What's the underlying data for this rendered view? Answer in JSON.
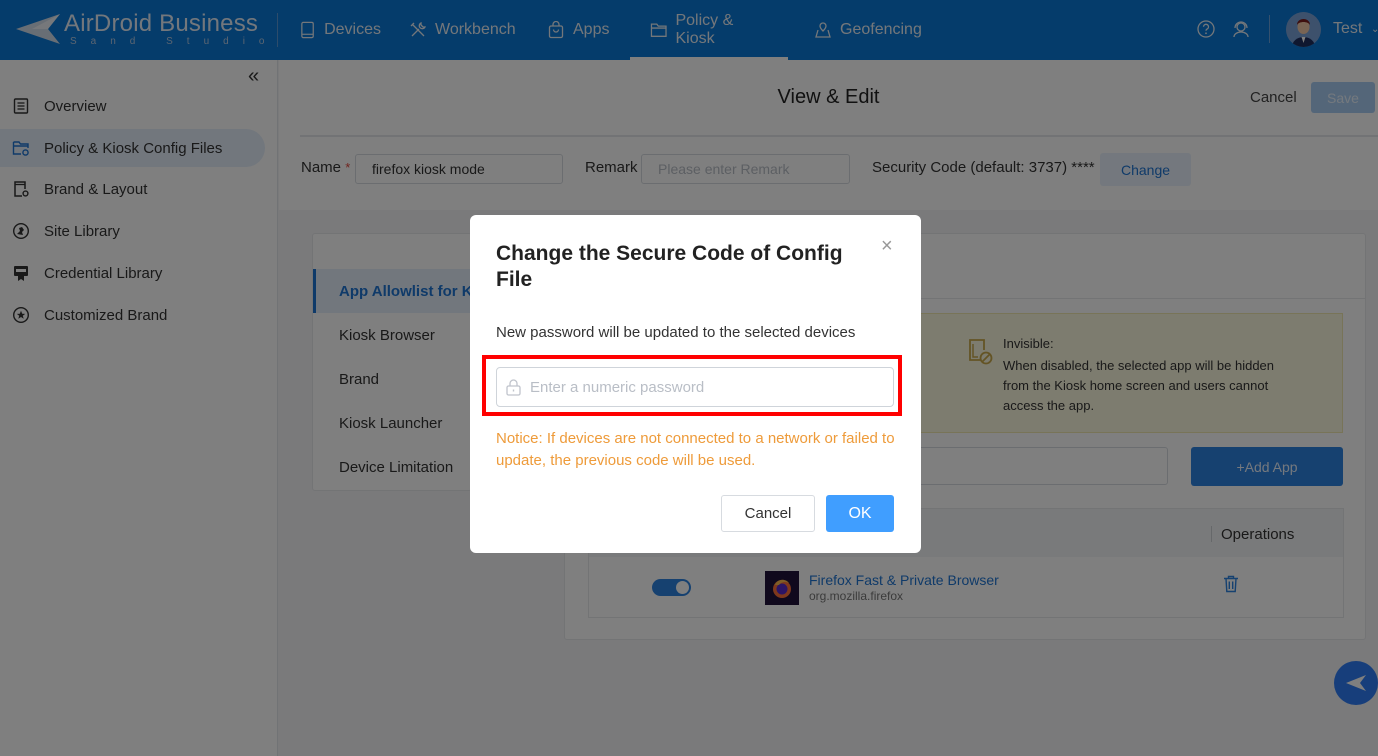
{
  "app": {
    "brand_name": "AirDroid Business",
    "brand_sub": "Sand Studio"
  },
  "topnav": {
    "items": [
      {
        "label": "Devices",
        "icon": "tablet-icon"
      },
      {
        "label": "Workbench",
        "icon": "tools-icon"
      },
      {
        "label": "Apps",
        "icon": "shopping-bag-icon"
      },
      {
        "label": "Policy & Kiosk",
        "icon": "folder-icon",
        "active": true
      },
      {
        "label": "Geofencing",
        "icon": "map-pin-icon"
      }
    ],
    "user_name": "Test"
  },
  "sidebar": {
    "collapse_glyph": "«",
    "items": [
      {
        "label": "Overview",
        "icon": "document-icon"
      },
      {
        "label": "Policy & Kiosk Config Files",
        "icon": "folder-gear-icon",
        "active": true
      },
      {
        "label": "Brand & Layout",
        "icon": "device-gear-icon"
      },
      {
        "label": "Site Library",
        "icon": "globe-icon"
      },
      {
        "label": "Credential Library",
        "icon": "certificate-icon"
      },
      {
        "label": "Customized Brand",
        "icon": "star-circle-icon"
      }
    ]
  },
  "header": {
    "title": "View & Edit",
    "cancel_label": "Cancel",
    "save_label": "Save",
    "name_label": "Name",
    "required_mark": "*",
    "name_value": "firefox kiosk mode",
    "remark_label": "Remark",
    "remark_placeholder": "Please enter Remark",
    "security_label": "Security Code (default: 3737) ****",
    "change_label": "Change"
  },
  "config_tabs": [
    {
      "label": "App Allowlist for Kiosk",
      "active": true
    },
    {
      "label": "Kiosk Browser"
    },
    {
      "label": "Brand"
    },
    {
      "label": "Kiosk Launcher"
    },
    {
      "label": "Device Limitation"
    }
  ],
  "content": {
    "info_title": "Invisible:",
    "info_text": "When disabled, the selected app will be hidden from the Kiosk home screen and users cannot access the app.",
    "add_app_label": "+Add App",
    "table": {
      "operations_header": "Operations",
      "rows": [
        {
          "enabled": true,
          "name": "Firefox Fast & Private Browser",
          "package": "org.mozilla.firefox"
        }
      ]
    }
  },
  "modal": {
    "title": "Change the Secure Code of Config File",
    "description": "New password will be updated to the selected devices",
    "password_placeholder": "Enter a numeric password",
    "password_value": "",
    "notice": "Notice: If devices are not connected to a network or failed to update, the previous code will be used.",
    "cancel_label": "Cancel",
    "ok_label": "OK",
    "close_glyph": "×"
  },
  "colors": {
    "primary": "#0a78d6",
    "accent_button": "#409eff",
    "notice": "#ee9b3a",
    "highlight_box": "#ff0000"
  }
}
